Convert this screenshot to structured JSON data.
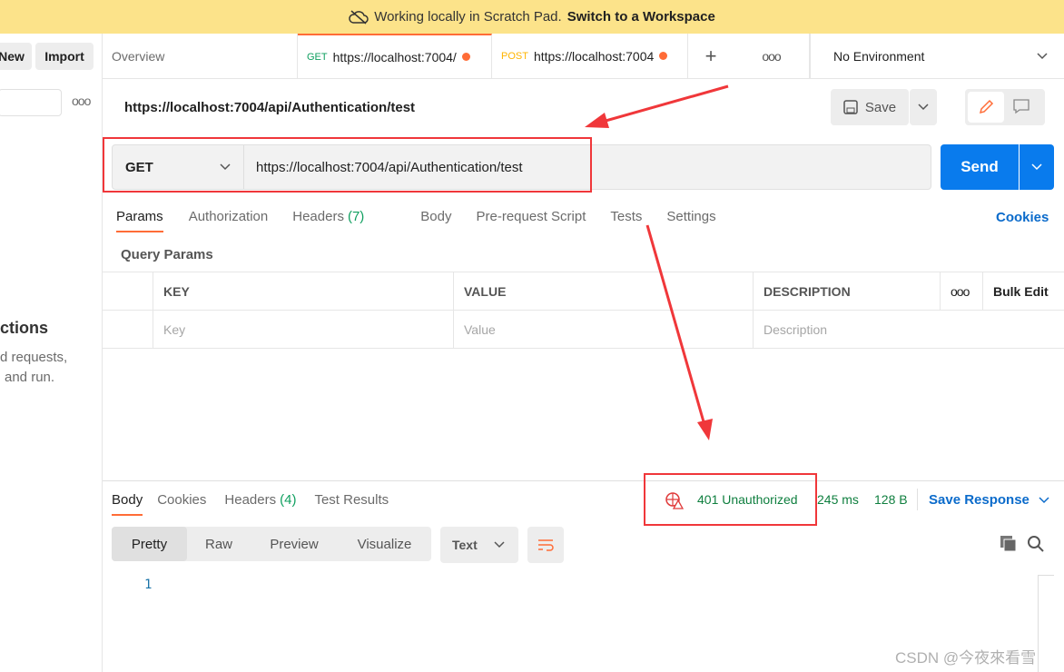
{
  "banner": {
    "icon": "cloud-off-icon",
    "text": "Working locally in Scratch Pad.",
    "link": "Switch to a Workspace"
  },
  "sidebar": {
    "new_label": "New",
    "import_label": "Import",
    "heading": "ctions",
    "line1": "d requests,",
    "line2": "and run."
  },
  "tabs": [
    {
      "label": "Overview"
    },
    {
      "method": "GET",
      "label": "https://localhost:7004/",
      "active": true
    },
    {
      "method": "POST",
      "label": "https://localhost:7004"
    }
  ],
  "environment": "No Environment",
  "request": {
    "title": "https://localhost:7004/api/Authentication/test",
    "save_label": "Save",
    "method": "GET",
    "url": "https://localhost:7004/api/Authentication/test",
    "send_label": "Send"
  },
  "request_tabs": [
    "Params",
    "Authorization",
    "Headers",
    "Body",
    "Pre-request Script",
    "Tests",
    "Settings"
  ],
  "headers_count": "(7)",
  "cookies_label": "Cookies",
  "query_params": {
    "title": "Query Params",
    "columns": [
      "KEY",
      "VALUE",
      "DESCRIPTION"
    ],
    "bulk_edit": "Bulk Edit",
    "placeholders": [
      "Key",
      "Value",
      "Description"
    ]
  },
  "response": {
    "tabs": [
      "Body",
      "Cookies",
      "Headers",
      "Test Results"
    ],
    "headers_count": "(4)",
    "status": "401 Unauthorized",
    "time": "245 ms",
    "size": "128 B",
    "save_response": "Save Response",
    "views": [
      "Pretty",
      "Raw",
      "Preview",
      "Visualize"
    ],
    "format": "Text",
    "line_number": "1"
  },
  "watermark": "CSDN @今夜來看雪",
  "colors": {
    "accent": "#ff6c37",
    "send": "#097bed",
    "status_green": "#0f7f3f",
    "annotation": "#f0373a",
    "banner": "#fce38a"
  }
}
